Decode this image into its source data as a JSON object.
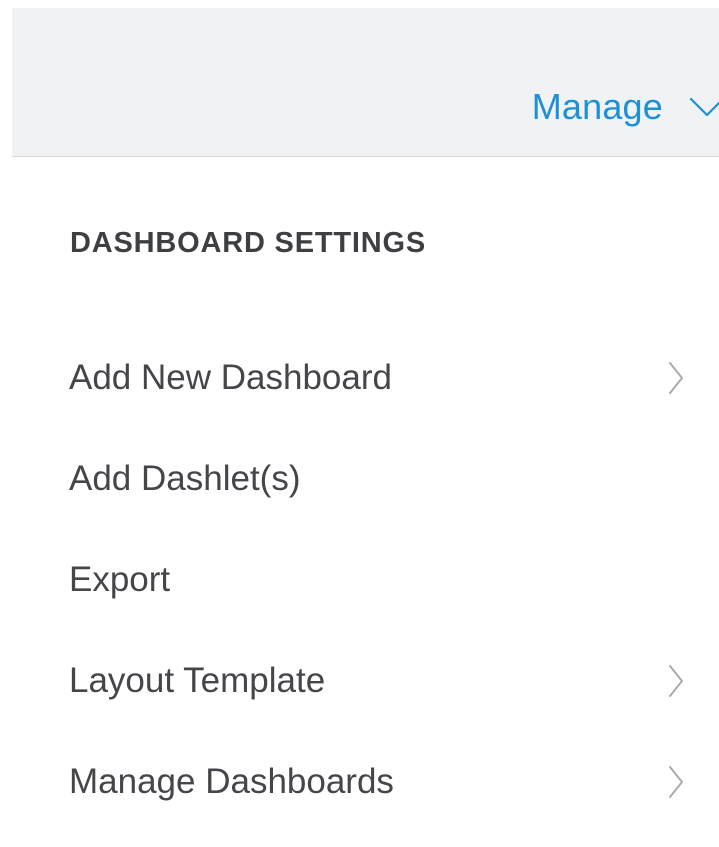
{
  "header": {
    "manage_label": "Manage",
    "manage_icon": "chevron-down-icon",
    "accent_color": "#1e90d6"
  },
  "menu": {
    "section_title": "DASHBOARD SETTINGS",
    "items": [
      {
        "label": "Add New Dashboard",
        "has_submenu": true
      },
      {
        "label": "Add Dashlet(s)",
        "has_submenu": false
      },
      {
        "label": "Export",
        "has_submenu": false
      },
      {
        "label": "Layout Template",
        "has_submenu": true
      },
      {
        "label": "Manage Dashboards",
        "has_submenu": true
      }
    ],
    "submenu_icon": "chevron-right-icon"
  }
}
